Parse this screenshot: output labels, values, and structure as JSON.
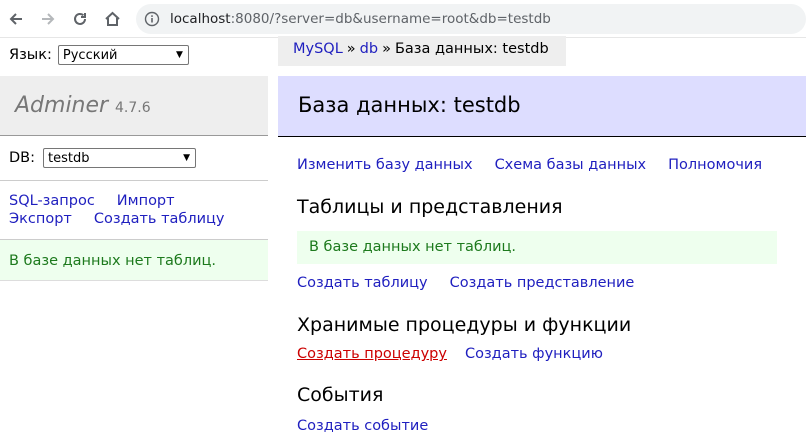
{
  "browser": {
    "url_host": "localhost",
    "url_rest": ":8080/?server=db&username=root&db=testdb"
  },
  "menu": {
    "language_label": "Язык:",
    "language_value": "Русский",
    "app_name": "Adminer",
    "version": "4.7.6",
    "db_label": "DB:",
    "db_value": "testdb",
    "links": {
      "sql": "SQL-запрос",
      "import": "Импорт",
      "export": "Экспорт",
      "create_table": "Создать таблицу"
    },
    "message": "В базе данных нет таблиц."
  },
  "breadcrumb": {
    "driver": "MySQL",
    "server": "db",
    "separator": "»",
    "current": "База данных: testdb"
  },
  "page": {
    "title": "База данных: testdb",
    "actions": {
      "alter_db": "Изменить базу данных",
      "schema": "Схема базы данных",
      "privileges": "Полномочия"
    },
    "tables_section": {
      "title": "Таблицы и представления",
      "message": "В базе данных нет таблиц.",
      "create_table": "Создать таблицу",
      "create_view": "Создать представление"
    },
    "routines_section": {
      "title": "Хранимые процедуры и функции",
      "create_procedure": "Создать процедуру",
      "create_function": "Создать функцию"
    },
    "events_section": {
      "title": "События",
      "create_event": "Создать событие"
    }
  }
}
